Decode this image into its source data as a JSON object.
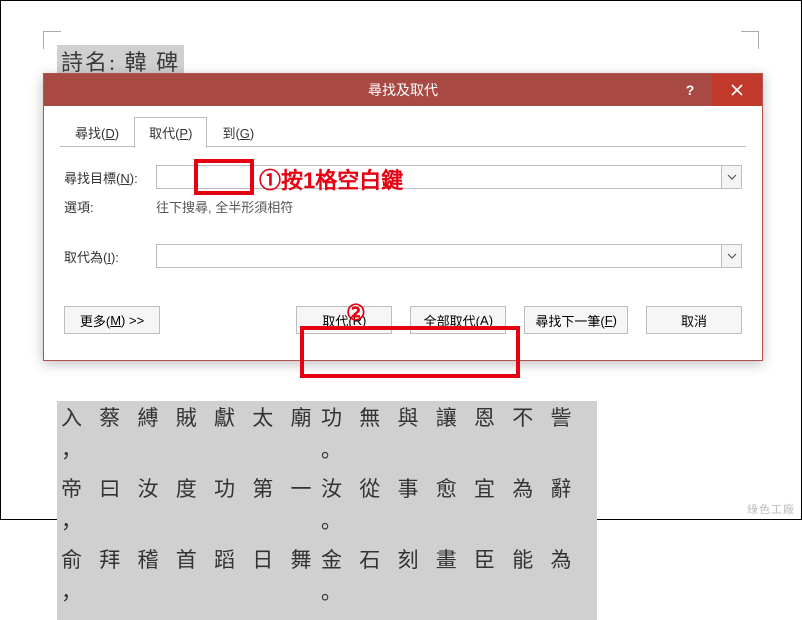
{
  "document": {
    "title": "詩名: 韓 碑",
    "lines": [
      {
        "c1": "入 蔡 縛 賊 獻 太 廟 ，",
        "c2": "功 無 與 讓 恩 不 訾 。"
      },
      {
        "c1": "帝 曰 汝 度 功 第 一 ，",
        "c2": "汝 從 事 愈 宜 為 辭 。"
      },
      {
        "c1": "俞 拜 稽 首 蹈 日 舞 ，",
        "c2": "金 石 刻 畫 臣 能 為 。"
      }
    ]
  },
  "dialog": {
    "title": "尋找及取代",
    "help_label": "?",
    "tabs": [
      {
        "label": "尋找(",
        "key": "D",
        "suffix": ")"
      },
      {
        "label": "取代(",
        "key": "P",
        "suffix": ")"
      },
      {
        "label": "到(",
        "key": "G",
        "suffix": ")"
      }
    ],
    "find_label_pre": "尋找目標(",
    "find_label_key": "N",
    "find_label_post": "):",
    "find_value": "",
    "options_label": "選項:",
    "options_value": "往下搜尋, 全半形須相符",
    "replace_label_pre": "取代為(",
    "replace_label_key": "I",
    "replace_label_post": "):",
    "replace_value": "",
    "buttons": {
      "more_pre": "更多(",
      "more_key": "M",
      "more_post": ") >>",
      "replace_pre": "取代(",
      "replace_key": "R",
      "replace_post": ")",
      "replace_all_pre": "全部取代(",
      "replace_all_key": "A",
      "replace_all_post": ")",
      "find_next_pre": "尋找下一筆(",
      "find_next_key": "F",
      "find_next_post": ")",
      "cancel": "取消"
    }
  },
  "annotations": {
    "step1": "①按1格空白鍵",
    "step2": "②"
  },
  "watermark": "綠色工廠"
}
